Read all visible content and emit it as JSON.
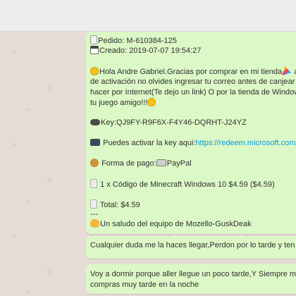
{
  "message_main": {
    "order_label": "Pedido: M-610384-125",
    "created_label": "Creado: 2019-07-07 19:54:27",
    "greeting_line1_a": "Hola Andre Gabriel.Gracias por comprar en mi tienda",
    "greeting_line1_b": " ac",
    "greeting_line2": "de activación no olvides ingresar tu correo antes de canjear la",
    "greeting_line3": "hacer por Internet(Te dejo un link) O por la tienda de Windows",
    "greeting_line4": "tu juego amigo!!!",
    "key_label": "Key:QJ9FY-R9F6X-F4Y46-DQRHT-J24YZ",
    "activate_label": "Puedes activar la key aqui:",
    "activate_link": "https://redeem.microsoft.com/",
    "payment_label": "Forma de pago:",
    "payment_method": "PayPal",
    "item_label": "1 x Código de Minecraft Windows 10   $4.59 ($4.59)",
    "total_label": "Total: $4.59",
    "separator": "---",
    "signoff": "Un saludo del equipo de Mozello-GuskDeak"
  },
  "message_2": {
    "text": "Cualquier duda me la haces llegar,Perdon por lo tarde y ten un"
  },
  "message_3": {
    "line1": "Voy a dormir porque aller llegue un poco tarde,Y Siempre me",
    "line2": "compras muy tarde en la noche"
  },
  "icons": [
    "clipboard-icon",
    "calendar-icon",
    "smile-emoji-icon",
    "party-popper-icon",
    "smile-emoji-icon",
    "gamepad-icon",
    "keyboard-icon",
    "money-bag-icon",
    "credit-card-icon",
    "page-icon",
    "page-icon",
    "waving-hand-icon"
  ],
  "colors": {
    "outgoing_bubble": "#dcf8c6",
    "chat_background": "#e5ddd5",
    "link": "#039be5"
  }
}
